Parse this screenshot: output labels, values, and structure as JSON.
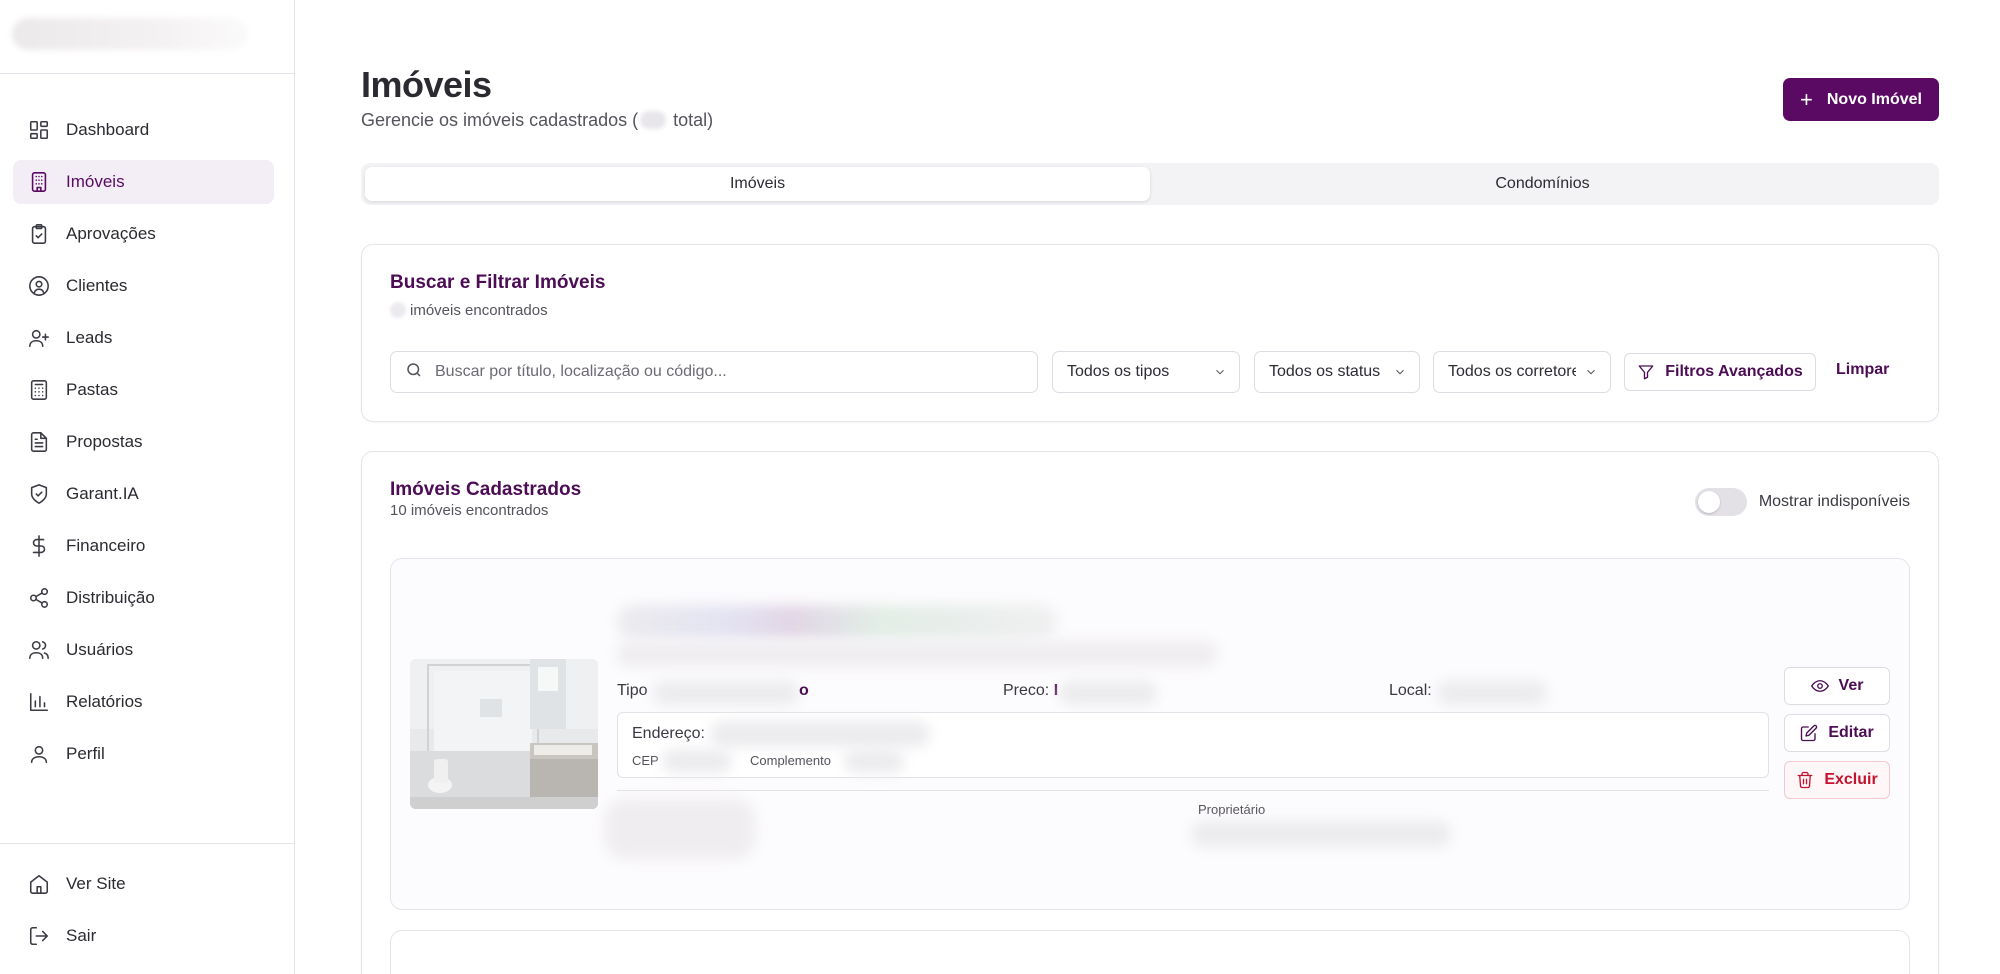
{
  "sidebar": {
    "items": [
      {
        "label": "Dashboard",
        "icon": "dashboard-icon"
      },
      {
        "label": "Imóveis",
        "icon": "building-icon",
        "active": true
      },
      {
        "label": "Aprovações",
        "icon": "clipboard-check-icon"
      },
      {
        "label": "Clientes",
        "icon": "user-circle-icon"
      },
      {
        "label": "Leads",
        "icon": "user-plus-icon"
      },
      {
        "label": "Pastas",
        "icon": "folder-grid-icon"
      },
      {
        "label": "Propostas",
        "icon": "document-icon"
      },
      {
        "label": "Garant.IA",
        "icon": "shield-check-icon"
      },
      {
        "label": "Financeiro",
        "icon": "dollar-icon"
      },
      {
        "label": "Distribuição",
        "icon": "share-icon"
      },
      {
        "label": "Usuários",
        "icon": "users-icon"
      },
      {
        "label": "Relatórios",
        "icon": "bar-chart-icon"
      },
      {
        "label": "Perfil",
        "icon": "user-icon"
      }
    ],
    "footer": [
      {
        "label": "Ver Site",
        "icon": "home-icon"
      },
      {
        "label": "Sair",
        "icon": "logout-icon"
      }
    ]
  },
  "header": {
    "title": "Imóveis",
    "subtitle_prefix": "Gerencie os imóveis cadastrados (",
    "subtitle_suffix": " total)",
    "new_button": "Novo Imóvel"
  },
  "tabs": [
    {
      "label": "Imóveis",
      "active": true
    },
    {
      "label": "Condomínios",
      "active": false
    }
  ],
  "filters": {
    "title": "Buscar e Filtrar Imóveis",
    "found_text": "imóveis encontrados",
    "search_placeholder": "Buscar por título, localização ou código...",
    "type_select": "Todos os tipos",
    "status_select": "Todos os status",
    "broker_select": "Todos os corretores",
    "advanced_button": "Filtros Avançados",
    "clear_button": "Limpar"
  },
  "list": {
    "title": "Imóveis Cadastrados",
    "count_text": "10 imóveis encontrados",
    "toggle_label": "Mostrar indisponíveis",
    "toggle_on": false
  },
  "property": {
    "type_label": "Tipo",
    "type_suffix": "o",
    "price_label": "Preco:",
    "price_prefix": "I",
    "location_label": "Local:",
    "address_label": "Endereço:",
    "cep_label": "CEP",
    "complement_label": "Complemento",
    "owner_label": "Proprietário",
    "actions": {
      "view": "Ver",
      "edit": "Editar",
      "delete": "Excluir"
    }
  },
  "colors": {
    "brand": "#5b0a63",
    "danger": "#c4132f"
  }
}
